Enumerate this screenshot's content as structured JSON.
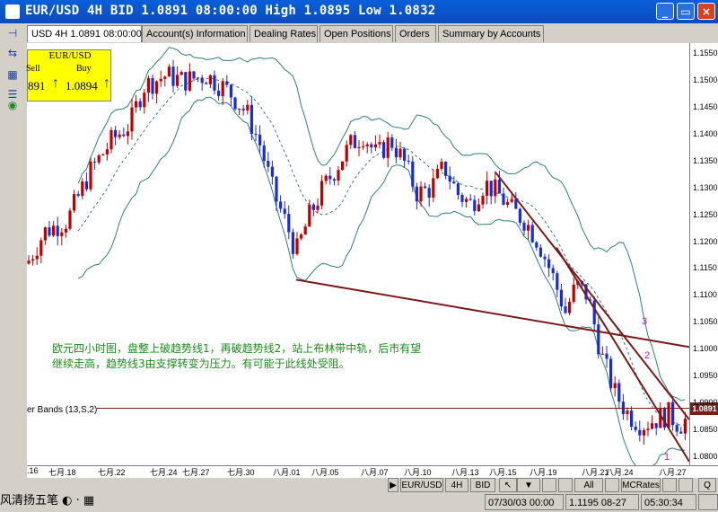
{
  "window": {
    "title": "EUR/USD 4H BID 1.0891 08:00:00 High 1.0895 Low 1.0832",
    "buttons": {
      "minimize": "_",
      "maximize": "▭",
      "close": "×"
    }
  },
  "tabs": [
    {
      "label": "USD 4H 1.0891 08:00:00"
    },
    {
      "label": "Account(s) Information"
    },
    {
      "label": "Dealing Rates"
    },
    {
      "label": "Open Positions"
    },
    {
      "label": "Orders"
    },
    {
      "label": "Summary by Accounts"
    }
  ],
  "quote": {
    "symbol": "EUR/USD",
    "sell_label": "Sell",
    "buy_label": "Buy",
    "sell_price": "891",
    "buy_price": "1.0894"
  },
  "annotation": {
    "line1": "欧元四小时图，盘整上破趋势线1，再破趋势线2，站上布林带中轨，后市有望",
    "line2": "继续走高，趋势线3由支撑转变为压力。有可能于此线处受阻。"
  },
  "indicator_label": "er Bands (13,S,2)",
  "trendline_labels": {
    "one": "1",
    "two": "2",
    "three": "3"
  },
  "chart_data": {
    "type": "candlestick",
    "symbol": "EUR/USD",
    "timeframe": "4H",
    "current_price": "1.0891",
    "indicator": "Bollinger Bands (13,S,2)",
    "y_ticks": [
      "1.1550",
      "1.1500",
      "1.1450",
      "1.1400",
      "1.1350",
      "1.1300",
      "1.1250",
      "1.1200",
      "1.1150",
      "1.1100",
      "1.1050",
      "1.1000",
      "1.0950",
      "1.0900",
      "1.0850",
      "1.0800"
    ],
    "ylim": [
      1.0785,
      1.157
    ],
    "x_ticks": [
      ".16",
      "七月.18",
      "七月.22",
      "七月.24",
      "七月.27",
      "七月.30",
      "八月.01",
      "八月.05",
      "八月.07",
      "八月.10",
      "八月.13",
      "八月.15",
      "八月.19",
      "八月.21",
      "八月.24",
      "八月.27"
    ]
  },
  "bottom": {
    "brand_text": "风清扬五笔",
    "symbol": "EUR/USD",
    "period": "4H",
    "bid": "BID",
    "all": "All",
    "mcrates": "MCRates",
    "q": "Q",
    "status_time": "07/30/03 00:00",
    "status_price": "1.1195 08-27",
    "status_clock": "05:30:34"
  },
  "colors": {
    "up_candle": "#c00000",
    "down_candle": "#1b2bd8",
    "bands": "#2e7d7d",
    "trendline": "#7a1a1a",
    "annotation": "#1a8c1a",
    "title_bar": "#0a50c8",
    "quote_bg": "#ffff00"
  }
}
